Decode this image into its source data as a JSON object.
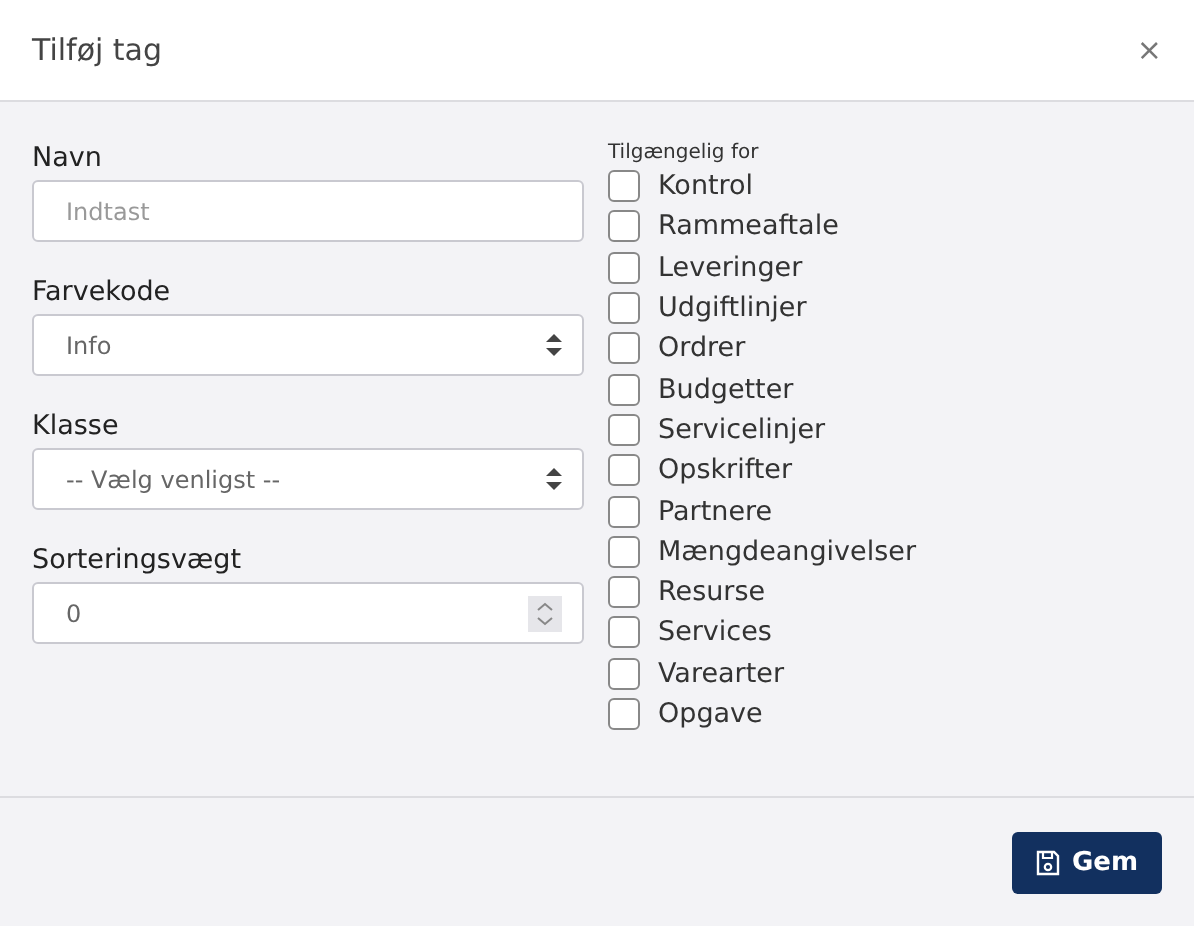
{
  "dialog": {
    "title": "Tilføj tag",
    "close": "×"
  },
  "fields": [
    {
      "kind": "text",
      "label": "Navn",
      "placeholder": "Indtast"
    },
    {
      "kind": "select",
      "label": "Farvekode",
      "value": "Info"
    },
    {
      "kind": "select",
      "label": "Klasse",
      "value": "-- Vælg venligst --"
    },
    {
      "kind": "number",
      "label": "Sorteringsvægt",
      "value": "0"
    }
  ],
  "availability": {
    "label": "Tilgængelig for",
    "options": [
      {
        "label": "Kontrol",
        "checked": false
      },
      {
        "label": "Rammeaftale",
        "checked": false
      },
      {
        "label": "Leveringer",
        "checked": false
      },
      {
        "label": "Udgiftlinjer",
        "checked": false
      },
      {
        "label": "Ordrer",
        "checked": false
      },
      {
        "label": "Budgetter",
        "checked": false
      },
      {
        "label": "Servicelinjer",
        "checked": false
      },
      {
        "label": "Opskrifter",
        "checked": false
      },
      {
        "label": "Partnere",
        "checked": false
      },
      {
        "label": "Mængdeangivelser",
        "checked": false
      },
      {
        "label": "Resurse",
        "checked": false
      },
      {
        "label": "Services",
        "checked": false
      },
      {
        "label": "Varearter",
        "checked": false
      },
      {
        "label": "Opgave",
        "checked": false
      }
    ]
  },
  "buttons": [
    {
      "label": "Gem"
    }
  ]
}
